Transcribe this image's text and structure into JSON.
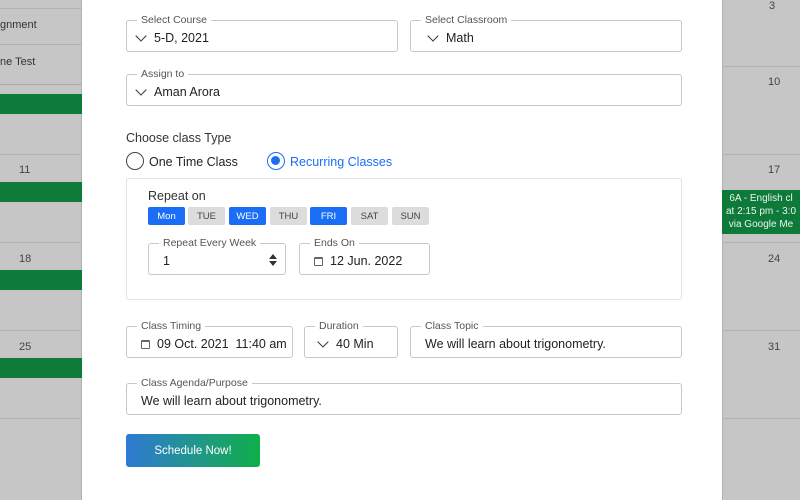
{
  "background_calendar": {
    "left_items": [
      "gnment",
      "ne Test"
    ],
    "date_numbers_left": [
      "11",
      "18",
      "25"
    ],
    "date_numbers_right": [
      "3",
      "10",
      "17",
      "24",
      "31"
    ],
    "event_lines": [
      "6A - English cl",
      "at 2:15 pm - 3:0",
      "via Google Me"
    ]
  },
  "form": {
    "select_course": {
      "label": "Select Course",
      "value": "5-D, 2021"
    },
    "select_classroom": {
      "label": "Select Classroom",
      "value": "Math"
    },
    "assign_to": {
      "label": "Assign to",
      "value": "Aman Arora"
    },
    "class_type": {
      "heading": "Choose class Type",
      "options": [
        {
          "label": "One Time Class",
          "selected": false
        },
        {
          "label": "Recurring Classes",
          "selected": true
        }
      ]
    },
    "repeat": {
      "heading": "Repeat on",
      "days": [
        {
          "label": "Mon",
          "selected": true
        },
        {
          "label": "TUE",
          "selected": false
        },
        {
          "label": "WED",
          "selected": true
        },
        {
          "label": "THU",
          "selected": false
        },
        {
          "label": "FRI",
          "selected": true
        },
        {
          "label": "SAT",
          "selected": false
        },
        {
          "label": "SUN",
          "selected": false
        }
      ],
      "repeat_every_week": {
        "label": "Repeat Every Week",
        "value": "1"
      },
      "ends_on": {
        "label": "Ends On",
        "value": "12 Jun. 2022"
      }
    },
    "class_timing": {
      "label": "Class Timing",
      "value": "09 Oct. 2021  11:40 am"
    },
    "duration": {
      "label": "Duration",
      "value": "40 Min"
    },
    "class_topic": {
      "label": "Class Topic",
      "value": "We will learn about trigonometry."
    },
    "class_agenda": {
      "label": "Class Agenda/Purpose",
      "value": "We will learn about trigonometry."
    },
    "submit_label": "Schedule Now!"
  },
  "colors": {
    "accent_blue": "#1a6ef5",
    "event_green": "#0e7a3a",
    "button_gradient_start": "#2f79d4",
    "button_gradient_end": "#0fae4a"
  }
}
